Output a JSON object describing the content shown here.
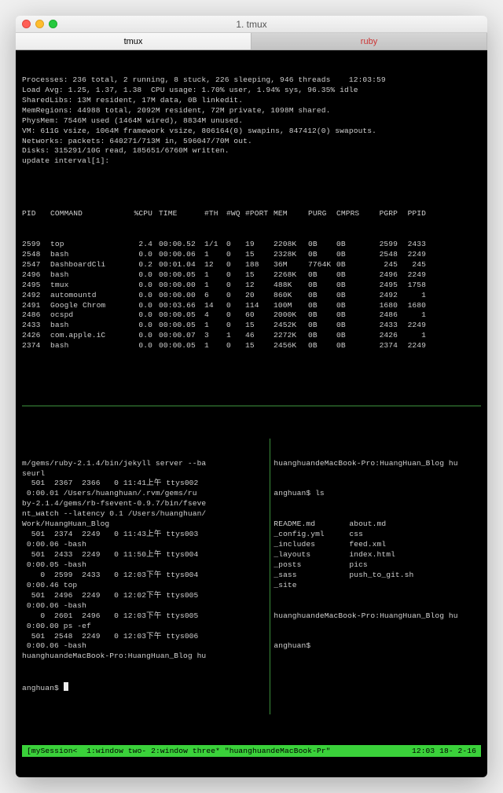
{
  "window": {
    "title": "1. tmux"
  },
  "tabs": [
    {
      "label": "tmux",
      "active": true
    },
    {
      "label": "ruby",
      "active": false
    }
  ],
  "top": {
    "summary": [
      "Processes: 236 total, 2 running, 8 stuck, 226 sleeping, 946 threads    12:03:59",
      "Load Avg: 1.25, 1.37, 1.38  CPU usage: 1.70% user, 1.94% sys, 96.35% idle",
      "SharedLibs: 13M resident, 17M data, 0B linkedit.",
      "MemRegions: 44988 total, 2092M resident, 72M private, 1098M shared.",
      "PhysMem: 7546M used (1464M wired), 8834M unused.",
      "VM: 611G vsize, 1064M framework vsize, 806164(0) swapins, 847412(0) swapouts.",
      "Networks: packets: 640271/713M in, 596047/70M out.",
      "Disks: 315291/10G read, 185651/6760M written.",
      "update interval[1]:"
    ],
    "columns": [
      "PID",
      "COMMAND",
      "%CPU",
      "TIME",
      "#TH",
      "#WQ",
      "#PORT",
      "MEM",
      "PURG",
      "CMPRS",
      "PGRP",
      "PPID"
    ],
    "rows": [
      {
        "pid": "2599",
        "cmd": "top",
        "cpu": "2.4",
        "time": "00:00.52",
        "th": "1/1",
        "wq": "0",
        "port": "19",
        "mem": "2208K",
        "purg": "0B",
        "cmprs": "0B",
        "pgrp": "2599",
        "ppid": "2433"
      },
      {
        "pid": "2548",
        "cmd": "bash",
        "cpu": "0.0",
        "time": "00:00.06",
        "th": "1",
        "wq": "0",
        "port": "15",
        "mem": "2328K",
        "purg": "0B",
        "cmprs": "0B",
        "pgrp": "2548",
        "ppid": "2249"
      },
      {
        "pid": "2547",
        "cmd": "DashboardCli",
        "cpu": "0.2",
        "time": "00:01.04",
        "th": "12",
        "wq": "0",
        "port": "188",
        "mem": "36M",
        "purg": "7764K",
        "cmprs": "0B",
        "pgrp": "245",
        "ppid": "245"
      },
      {
        "pid": "2496",
        "cmd": "bash",
        "cpu": "0.0",
        "time": "00:00.05",
        "th": "1",
        "wq": "0",
        "port": "15",
        "mem": "2268K",
        "purg": "0B",
        "cmprs": "0B",
        "pgrp": "2496",
        "ppid": "2249"
      },
      {
        "pid": "2495",
        "cmd": "tmux",
        "cpu": "0.0",
        "time": "00:00.00",
        "th": "1",
        "wq": "0",
        "port": "12",
        "mem": "488K",
        "purg": "0B",
        "cmprs": "0B",
        "pgrp": "2495",
        "ppid": "1758"
      },
      {
        "pid": "2492",
        "cmd": "automountd",
        "cpu": "0.0",
        "time": "00:00.00",
        "th": "6",
        "wq": "0",
        "port": "20",
        "mem": "860K",
        "purg": "0B",
        "cmprs": "0B",
        "pgrp": "2492",
        "ppid": "1"
      },
      {
        "pid": "2491",
        "cmd": "Google Chrom",
        "cpu": "0.0",
        "time": "00:03.66",
        "th": "14",
        "wq": "0",
        "port": "114",
        "mem": "100M",
        "purg": "0B",
        "cmprs": "0B",
        "pgrp": "1680",
        "ppid": "1680"
      },
      {
        "pid": "2486",
        "cmd": "ocspd",
        "cpu": "0.0",
        "time": "00:00.05",
        "th": "4",
        "wq": "0",
        "port": "60",
        "mem": "2000K",
        "purg": "0B",
        "cmprs": "0B",
        "pgrp": "2486",
        "ppid": "1"
      },
      {
        "pid": "2433",
        "cmd": "bash",
        "cpu": "0.0",
        "time": "00:00.05",
        "th": "1",
        "wq": "0",
        "port": "15",
        "mem": "2452K",
        "purg": "0B",
        "cmprs": "0B",
        "pgrp": "2433",
        "ppid": "2249"
      },
      {
        "pid": "2426",
        "cmd": "com.apple.iC",
        "cpu": "0.0",
        "time": "00:00.07",
        "th": "3",
        "wq": "1",
        "port": "46",
        "mem": "2272K",
        "purg": "0B",
        "cmprs": "0B",
        "pgrp": "2426",
        "ppid": "1"
      },
      {
        "pid": "2374",
        "cmd": "bash",
        "cpu": "0.0",
        "time": "00:00.05",
        "th": "1",
        "wq": "0",
        "port": "15",
        "mem": "2456K",
        "purg": "0B",
        "cmprs": "0B",
        "pgrp": "2374",
        "ppid": "2249"
      }
    ]
  },
  "left_pane": {
    "lines": [
      "m/gems/ruby-2.1.4/bin/jekyll server --ba",
      "seurl",
      "  501  2367  2366   0 11:41上午 ttys002",
      " 0:00.01 /Users/huanghuan/.rvm/gems/ru",
      "by-2.1.4/gems/rb-fsevent-0.9.7/bin/fseve",
      "nt_watch --latency 0.1 /Users/huanghuan/",
      "Work/HuangHuan_Blog",
      "  501  2374  2249   0 11:43上午 ttys003",
      " 0:00.06 -bash",
      "  501  2433  2249   0 11:50上午 ttys004",
      " 0:00.05 -bash",
      "    0  2599  2433   0 12:03下午 ttys004",
      " 0:00.46 top",
      "  501  2496  2249   0 12:02下午 ttys005",
      " 0:00.06 -bash",
      "    0  2601  2496   0 12:03下午 ttys005",
      " 0:00.00 ps -ef",
      "  501  2548  2249   0 12:03下午 ttys006",
      " 0:00.06 -bash",
      "huanghuandeMacBook-Pro:HuangHuan_Blog hu"
    ],
    "prompt": "anghuan$ "
  },
  "right_pane": {
    "prompt1": "huanghuandeMacBook-Pro:HuangHuan_Blog hu",
    "prompt2": "anghuan$ ls",
    "ls": [
      [
        "README.md",
        "about.md"
      ],
      [
        "_config.yml",
        "css"
      ],
      [
        "_includes",
        "feed.xml"
      ],
      [
        "_layouts",
        "index.html"
      ],
      [
        "_posts",
        "pics"
      ],
      [
        "_sass",
        "push_to_git.sh"
      ],
      [
        "_site",
        ""
      ]
    ],
    "prompt3": "huanghuandeMacBook-Pro:HuangHuan_Blog hu",
    "prompt4": "anghuan$"
  },
  "status": {
    "left": "[mySession<  1:window two- 2:window three* \"huanghuandeMacBook-Pr\"",
    "right": "12:03 18- 2-16"
  }
}
